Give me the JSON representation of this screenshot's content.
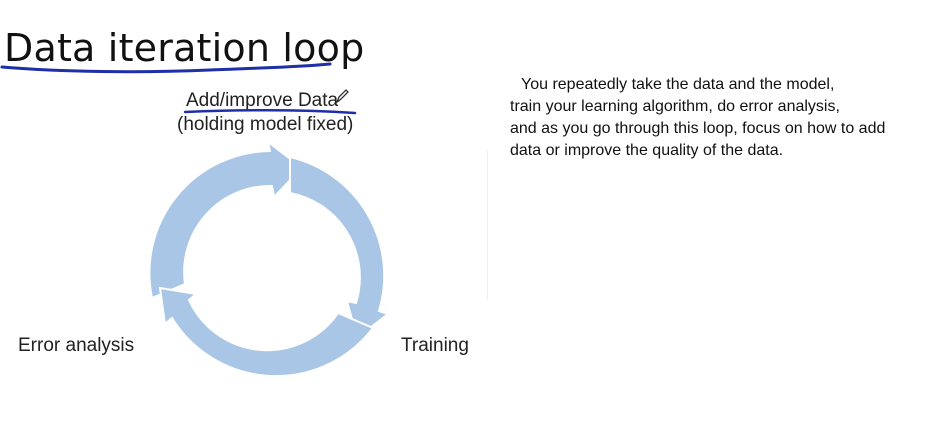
{
  "slide": {
    "title": "Data iteration loop"
  },
  "diagram": {
    "top_label_line1": "Add/improve Data",
    "top_label_line2": "(holding model fixed)",
    "right_label": "Training",
    "left_label": "Error analysis",
    "arrow_color": "#a9c6e6",
    "annotation_color": "#1f2fa8"
  },
  "description": {
    "lines": [
      "You repeatedly take the data and the model,",
      "train your learning algorithm, do error analysis,",
      "and as you go through this loop, focus on how to add",
      "data or improve the quality of the data."
    ]
  }
}
